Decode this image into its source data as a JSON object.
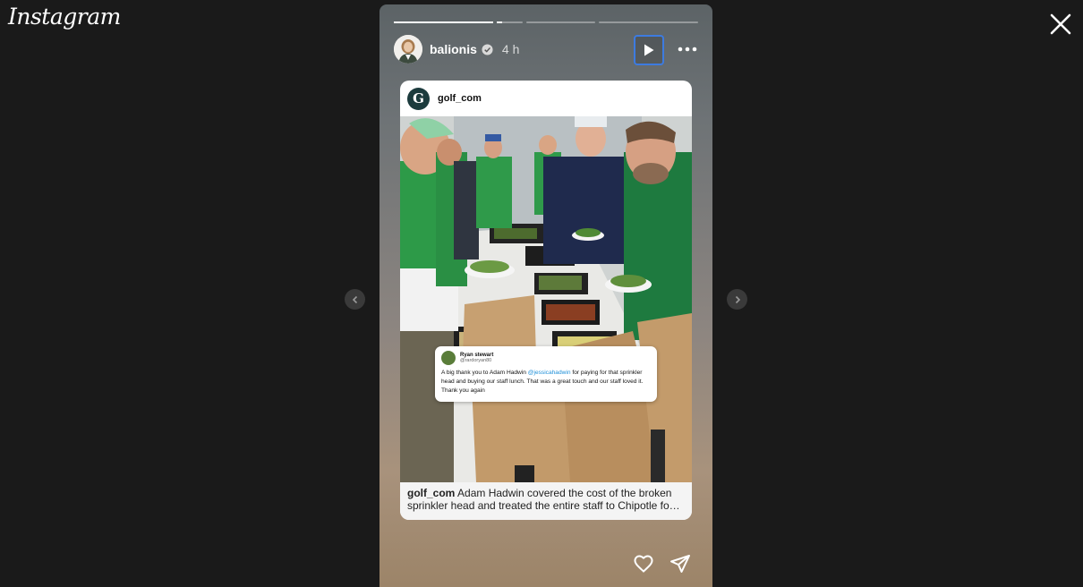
{
  "app": {
    "logo_text": "Instagram"
  },
  "story": {
    "progress": [
      1,
      0.2,
      0,
      0
    ],
    "user": {
      "username": "balionis",
      "verified": true,
      "time_ago": "4 h"
    }
  },
  "post": {
    "username": "golf_com",
    "logo_letter": "G",
    "caption_user": "golf_com",
    "caption_text": "Adam Hadwin covered the cost of the broken sprinkler head and treated the entire staff to Chipotle fo…",
    "tweet": {
      "name": "Ryan stewart",
      "handle": "@rardoryan80",
      "text_before": "A big thank you to Adam Hadwin ",
      "mention": "@jessicahadwin",
      "text_after": " for paying for that sprinkler head and buying our staff lunch. That was a great touch and our staff loved it. Thank you again"
    }
  },
  "icons": {
    "close": "close-icon",
    "prev": "chevron-left-icon",
    "next": "chevron-right-icon",
    "play": "play-icon",
    "more": "more-horizontal-icon",
    "like": "heart-icon",
    "send": "send-icon"
  },
  "colors": {
    "accent": "#3d7be0",
    "golf_green": "#1c3b3d"
  }
}
